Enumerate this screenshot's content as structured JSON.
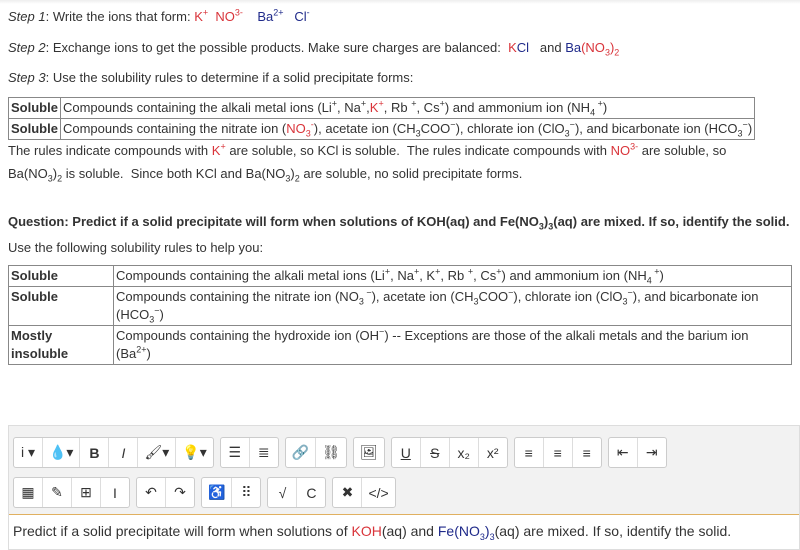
{
  "step1": [
    {
      "t": "Step 1",
      "i": 1
    },
    {
      "t": ": Write the ions that form: "
    },
    {
      "t": "K",
      "c": "red"
    },
    {
      "t": "+",
      "c": "red",
      "s": "sup"
    },
    {
      "t": "  NO",
      "c": "red"
    },
    {
      "t": "3-",
      "c": "red",
      "s": "sup"
    },
    {
      "t": "    Ba",
      "c": "blue"
    },
    {
      "t": "2+",
      "c": "blue",
      "s": "sup"
    },
    {
      "t": "   Cl",
      "c": "blue"
    },
    {
      "t": "-",
      "c": "blue",
      "s": "sup"
    }
  ],
  "step2": [
    {
      "t": "Step 2",
      "i": 1
    },
    {
      "t": ": Exchange ions to get the possible products. Make sure charges are balanced:  "
    },
    {
      "t": "K",
      "c": "red"
    },
    {
      "t": "Cl",
      "c": "blue"
    },
    {
      "t": "   and "
    },
    {
      "t": "Ba",
      "c": "blue"
    },
    {
      "t": "(NO",
      "c": "red"
    },
    {
      "t": "3",
      "c": "red",
      "s": "sub"
    },
    {
      "t": ")",
      "c": "red"
    },
    {
      "t": "2",
      "c": "red",
      "s": "sub"
    }
  ],
  "step3": [
    {
      "t": "Step 3",
      "i": 1
    },
    {
      "t": ": Use the solubility rules to determine if a solid precipitate forms:"
    }
  ],
  "table1": [
    {
      "k": "Soluble",
      "v": [
        {
          "t": "Compounds containing the alkali metal ions (Li"
        },
        {
          "t": "+",
          "s": "sup"
        },
        {
          "t": ", Na"
        },
        {
          "t": "+",
          "s": "sup"
        },
        {
          "t": ","
        },
        {
          "t": "K",
          "c": "red"
        },
        {
          "t": "+",
          "c": "red",
          "s": "sup"
        },
        {
          "t": ", Rb "
        },
        {
          "t": "+",
          "s": "sup"
        },
        {
          "t": ", Cs"
        },
        {
          "t": "+",
          "s": "sup"
        },
        {
          "t": ") and ammonium ion (NH"
        },
        {
          "t": "4",
          "s": "sub"
        },
        {
          "t": " +",
          "s": "sup"
        },
        {
          "t": ")"
        }
      ]
    },
    {
      "k": "Soluble",
      "v": [
        {
          "t": "Compounds containing the nitrate ion ("
        },
        {
          "t": "NO",
          "c": "red"
        },
        {
          "t": "3",
          "c": "red",
          "s": "sub"
        },
        {
          "t": "-",
          "c": "red",
          "s": "sup"
        },
        {
          "t": "), acetate ion (CH"
        },
        {
          "t": "3",
          "s": "sub"
        },
        {
          "t": "COO"
        },
        {
          "t": "−",
          "s": "sup"
        },
        {
          "t": "), chlorate ion (ClO"
        },
        {
          "t": "3",
          "s": "sub"
        },
        {
          "t": "−",
          "s": "sup"
        },
        {
          "t": "), and bicarbonate ion (HCO"
        },
        {
          "t": "3",
          "s": "sub"
        },
        {
          "t": "−",
          "s": "sup"
        },
        {
          "t": ")"
        }
      ]
    }
  ],
  "conclusion1": [
    {
      "t": "The rules indicate compounds with "
    },
    {
      "t": "K",
      "c": "red"
    },
    {
      "t": "+",
      "c": "red",
      "s": "sup"
    },
    {
      "t": " are soluble, so KCl is soluble.  The rules indicate compounds with "
    },
    {
      "t": "NO",
      "c": "red"
    },
    {
      "t": "3-",
      "c": "red",
      "s": "sup"
    },
    {
      "t": " are soluble, so"
    }
  ],
  "conclusion2": [
    {
      "t": "Ba(NO"
    },
    {
      "t": "3",
      "s": "sub"
    },
    {
      "t": ")"
    },
    {
      "t": "2",
      "s": "sub"
    },
    {
      "t": " is soluble.  Since both KCl and Ba(NO"
    },
    {
      "t": "3",
      "s": "sub"
    },
    {
      "t": ")"
    },
    {
      "t": "2",
      "s": "sub"
    },
    {
      "t": " are soluble, no solid precipitate forms."
    }
  ],
  "question": [
    {
      "t": "Question: Predict if a solid precipitate will form when solutions of KOH(aq) and Fe(NO"
    },
    {
      "t": "3",
      "s": "sub"
    },
    {
      "t": ")"
    },
    {
      "t": "3",
      "s": "sub"
    },
    {
      "t": "(aq) are mixed. If so, identify the solid."
    }
  ],
  "hint": [
    {
      "t": "Use the following solubility rules to help you:"
    }
  ],
  "table2": [
    {
      "k": "Soluble",
      "v": [
        {
          "t": "Compounds containing the alkali metal ions (Li"
        },
        {
          "t": "+",
          "s": "sup"
        },
        {
          "t": ", Na"
        },
        {
          "t": "+",
          "s": "sup"
        },
        {
          "t": ", K"
        },
        {
          "t": "+",
          "s": "sup"
        },
        {
          "t": ", Rb "
        },
        {
          "t": "+",
          "s": "sup"
        },
        {
          "t": ", Cs"
        },
        {
          "t": "+",
          "s": "sup"
        },
        {
          "t": ") and ammonium ion (NH"
        },
        {
          "t": "4",
          "s": "sub"
        },
        {
          "t": " +",
          "s": "sup"
        },
        {
          "t": ")"
        }
      ]
    },
    {
      "k": "Soluble",
      "v": [
        {
          "t": "Compounds containing the nitrate ion (NO"
        },
        {
          "t": "3",
          "s": "sub"
        },
        {
          "t": " −",
          "s": "sup"
        },
        {
          "t": "), acetate ion (CH"
        },
        {
          "t": "3",
          "s": "sub"
        },
        {
          "t": "COO"
        },
        {
          "t": "−",
          "s": "sup"
        },
        {
          "t": "), chlorate ion (ClO"
        },
        {
          "t": "3",
          "s": "sub"
        },
        {
          "t": "−",
          "s": "sup"
        },
        {
          "t": "), and bicarbonate ion (HCO"
        },
        {
          "t": "3",
          "s": "sub"
        },
        {
          "t": "−",
          "s": "sup"
        },
        {
          "t": ")"
        }
      ]
    },
    {
      "k": "Mostly insoluble",
      "v": [
        {
          "t": "Compounds containing the hydroxide ion (OH"
        },
        {
          "t": "−",
          "s": "sup"
        },
        {
          "t": ") -- Exceptions are those of the alkali metals and the barium ion "
        },
        {
          "br": 1
        },
        {
          "t": "(Ba"
        },
        {
          "t": "2+",
          "s": "sup"
        },
        {
          "t": ")"
        }
      ]
    }
  ],
  "toolbar": {
    "row1": [
      [
        {
          "n": "info-dropdown",
          "l": "i ▾"
        },
        {
          "n": "color-dropdown",
          "l": "💧▾"
        },
        {
          "n": "bold",
          "l": "B"
        },
        {
          "n": "italic",
          "l": "I"
        },
        {
          "n": "brush-dropdown",
          "l": "🖌▾"
        },
        {
          "n": "hint-dropdown",
          "l": "💡▾"
        }
      ],
      [
        {
          "n": "bulleted-list",
          "l": "☰"
        },
        {
          "n": "numbered-list",
          "l": "≣"
        }
      ],
      [
        {
          "n": "link",
          "l": "🔗"
        },
        {
          "n": "unlink",
          "l": "⛓"
        }
      ],
      [
        {
          "n": "image",
          "l": "🖼"
        }
      ],
      [
        {
          "n": "underline",
          "l": "U"
        },
        {
          "n": "strikethrough",
          "l": "S"
        },
        {
          "n": "subscript",
          "l": "x₂"
        },
        {
          "n": "superscript",
          "l": "x²"
        }
      ],
      [
        {
          "n": "align-left",
          "l": "≡"
        },
        {
          "n": "align-center",
          "l": "≡"
        },
        {
          "n": "align-right",
          "l": "≡"
        }
      ],
      [
        {
          "n": "outdent",
          "l": "⇤"
        },
        {
          "n": "indent",
          "l": "⇥"
        }
      ]
    ],
    "row2": [
      [
        {
          "n": "calculator",
          "l": "▦"
        },
        {
          "n": "edit",
          "l": "✎"
        },
        {
          "n": "table",
          "l": "⊞"
        },
        {
          "n": "cursor",
          "l": "I"
        }
      ],
      [
        {
          "n": "undo",
          "l": "↶"
        },
        {
          "n": "redo",
          "l": "↷"
        }
      ],
      [
        {
          "n": "accessibility",
          "l": "♿"
        },
        {
          "n": "braille",
          "l": "⠿"
        }
      ],
      [
        {
          "n": "equation",
          "l": "√"
        },
        {
          "n": "chemistry",
          "l": "C"
        }
      ],
      [
        {
          "n": "fullscreen",
          "l": "✖"
        },
        {
          "n": "html-source",
          "l": "</>"
        }
      ]
    ]
  },
  "editor_content": [
    {
      "t": "Predict if a solid precipitate will form when solutions of "
    },
    {
      "t": "KOH",
      "c": "red"
    },
    {
      "t": "(aq) and "
    },
    {
      "t": "Fe(NO",
      "c": "blue"
    },
    {
      "t": "3",
      "c": "blue",
      "s": "sub"
    },
    {
      "t": ")",
      "c": "blue"
    },
    {
      "t": "3",
      "c": "blue",
      "s": "sub"
    },
    {
      "t": "(aq) are mixed. If so, identify the solid."
    }
  ]
}
